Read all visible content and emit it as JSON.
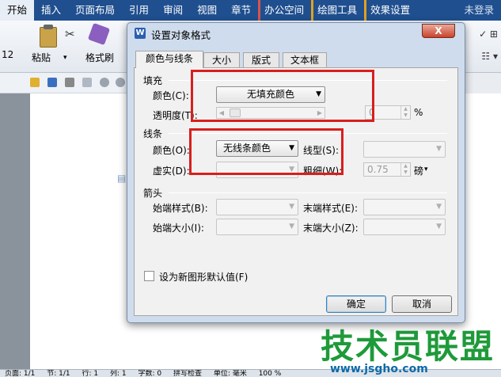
{
  "menubar": {
    "items": [
      "开始",
      "插入",
      "页面布局",
      "引用",
      "审阅",
      "视图",
      "章节",
      "办公空间",
      "绘图工具",
      "效果设置",
      "未登录"
    ]
  },
  "ribbon": {
    "paste_label": "粘贴",
    "format_painter_label": "格式刷",
    "left_number": "12"
  },
  "dialog": {
    "title": "设置对象格式",
    "app_icon_letter": "W",
    "close_label": "X",
    "tabs": [
      "颜色与线条",
      "大小",
      "版式",
      "文本框"
    ],
    "fill": {
      "heading": "填充",
      "color_label": "颜色(C):",
      "color_value": "无填充颜色",
      "transparency_label": "透明度(T):",
      "transparency_value": "0",
      "percent_unit": "%"
    },
    "line": {
      "heading": "线条",
      "color_label": "颜色(O):",
      "color_value": "无线条颜色",
      "style_label": "线型(S):",
      "dash_label": "虚实(D):",
      "weight_label": "粗细(W):",
      "weight_value": "0.75",
      "weight_unit": "磅"
    },
    "arrows": {
      "heading": "箭头",
      "begin_style_label": "始端样式(B):",
      "end_style_label": "末端样式(E):",
      "begin_size_label": "始端大小(I):",
      "end_size_label": "末端大小(Z):"
    },
    "default_checkbox_label": "设为新图形默认值(F)",
    "ok_label": "确定",
    "cancel_label": "取消"
  },
  "statusbar": {
    "items": [
      "页面: 1/1",
      "节: 1/1",
      "行: 1",
      "列: 1",
      "字数: 0",
      "拼写检查",
      "单位: 毫米",
      "100 %"
    ]
  },
  "watermark": {
    "title": "技术员联盟",
    "url": "www.jsgho.com"
  },
  "colors": {
    "menubar": "#1f4f8f",
    "highlight": "#d81e1e",
    "watermark_green": "#1f9a3a",
    "watermark_blue": "#0d6aa8"
  }
}
